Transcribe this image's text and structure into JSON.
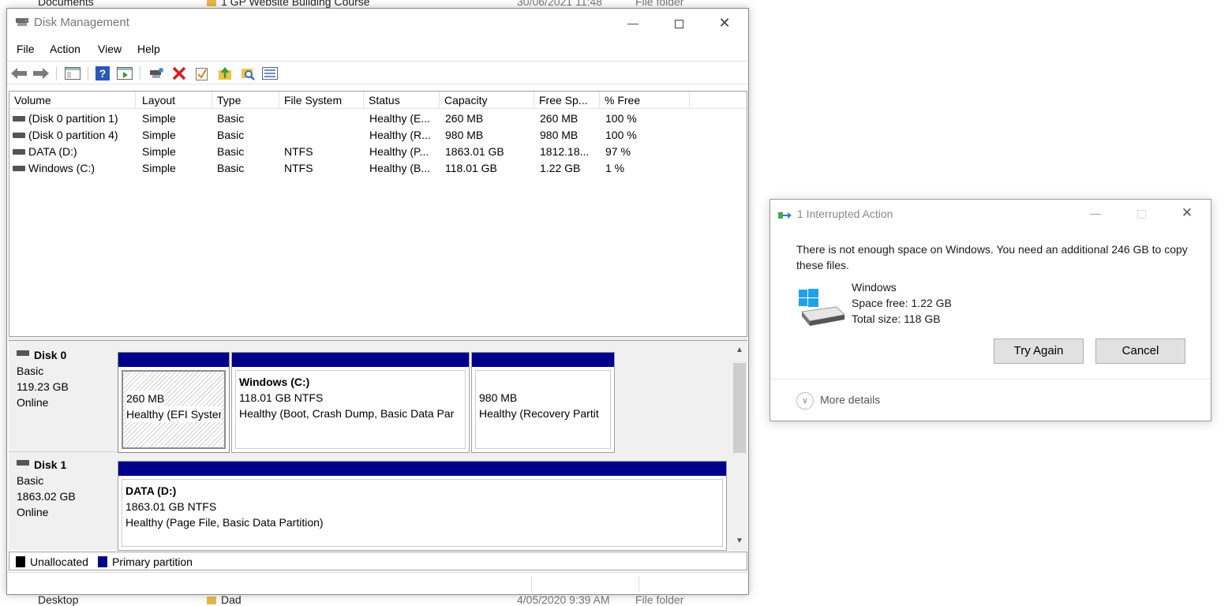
{
  "background": {
    "top_row": {
      "name": "1 GP Website Building Course",
      "date": "30/06/2021 11:48",
      "type": "File folder",
      "nav": "Documents"
    },
    "bottom_row": {
      "name": "Dad",
      "date": "4/05/2020 9:39 AM",
      "type": "File folder",
      "nav": "Desktop"
    }
  },
  "window": {
    "title": "Disk Management",
    "menu": [
      "File",
      "Action",
      "View",
      "Help"
    ]
  },
  "toolbar_icons": [
    "back-icon",
    "forward-icon",
    "console-tree-icon",
    "help-icon",
    "properties-icon",
    "connect-icon",
    "delete-icon",
    "check-icon",
    "export-icon",
    "search-icon",
    "list-icon"
  ],
  "volumes": {
    "columns": [
      "Volume",
      "Layout",
      "Type",
      "File System",
      "Status",
      "Capacity",
      "Free Sp...",
      "% Free"
    ],
    "rows": [
      {
        "volume": "(Disk 0 partition 1)",
        "layout": "Simple",
        "type": "Basic",
        "fs": "",
        "status": "Healthy (E...",
        "capacity": "260 MB",
        "free": "260 MB",
        "pct": "100 %"
      },
      {
        "volume": "(Disk 0 partition 4)",
        "layout": "Simple",
        "type": "Basic",
        "fs": "",
        "status": "Healthy (R...",
        "capacity": "980 MB",
        "free": "980 MB",
        "pct": "100 %"
      },
      {
        "volume": "DATA (D:)",
        "layout": "Simple",
        "type": "Basic",
        "fs": "NTFS",
        "status": "Healthy (P...",
        "capacity": "1863.01 GB",
        "free": "1812.18...",
        "pct": "97 %"
      },
      {
        "volume": "Windows (C:)",
        "layout": "Simple",
        "type": "Basic",
        "fs": "NTFS",
        "status": "Healthy (B...",
        "capacity": "118.01 GB",
        "free": "1.22 GB",
        "pct": "1 %"
      }
    ]
  },
  "disks": [
    {
      "name": "Disk 0",
      "type": "Basic",
      "size": "119.23 GB",
      "state": "Online",
      "partitions": [
        {
          "title": "",
          "size": "260 MB",
          "status": "Healthy (EFI Syster"
        },
        {
          "title": "Windows  (C:)",
          "size": "118.01 GB NTFS",
          "status": "Healthy (Boot, Crash Dump, Basic Data Par"
        },
        {
          "title": "",
          "size": "980 MB",
          "status": "Healthy (Recovery Partit"
        }
      ]
    },
    {
      "name": "Disk 1",
      "type": "Basic",
      "size": "1863.02 GB",
      "state": "Online",
      "partitions": [
        {
          "title": "DATA  (D:)",
          "size": "1863.01 GB NTFS",
          "status": "Healthy (Page File, Basic Data Partition)"
        }
      ]
    }
  ],
  "legend": [
    {
      "label": "Unallocated",
      "color": "#000000"
    },
    {
      "label": "Primary partition",
      "color": "#00008b"
    }
  ],
  "dialog": {
    "title": "1 Interrupted Action",
    "message": "There is not enough space on Windows. You need an additional 246 GB to copy these files.",
    "drive_name": "Windows",
    "space_free": "Space free: 1.22 GB",
    "total_size": "Total size: 118 GB",
    "try_again": "Try Again",
    "cancel": "Cancel",
    "more_details": "More details"
  },
  "colors": {
    "primary_partition": "#00008b",
    "accent": "#0078d7"
  }
}
